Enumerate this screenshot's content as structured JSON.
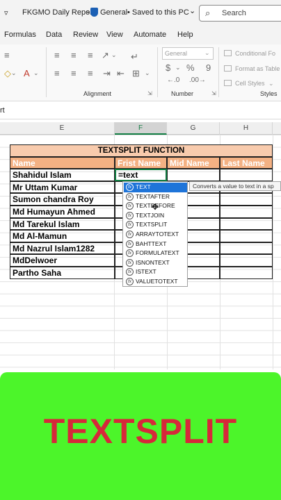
{
  "titlebar": {
    "dropdown_glyph": "▿",
    "file_name": "FKGMO Daily Report",
    "dropdown_arrow": "⌄",
    "sensitivity": "General",
    "save_state": "• Saved to this PC",
    "save_caret": "⌄",
    "search_placeholder": "Search"
  },
  "menu": [
    "Formulas",
    "Data",
    "Review",
    "View",
    "Automate",
    "Help"
  ],
  "ribbon": {
    "alignment_label": "Alignment",
    "number_label": "Number",
    "styles_label": "Styles",
    "number_format": "General",
    "conditional": "Conditional Fo",
    "format_as_table": "Format as Table",
    "cell_styles": "Cell Styles",
    "currency": "$",
    "percent": "%",
    "comma": "9"
  },
  "formula_bar": {
    "name_fragment": "rt"
  },
  "columns": [
    "E",
    "F",
    "G",
    "H"
  ],
  "table": {
    "title": "TEXTSPLIT FUNCTION",
    "headers": [
      "Name",
      "Frist Name",
      "Mid Name",
      "Last Name"
    ],
    "active_formula": "=text",
    "names": [
      "Shahidul Islam",
      "Mr Uttam Kumar",
      "Sumon chandra Roy",
      "Md Humayun Ahmed",
      "Md Tarekul Islam",
      "Md Al-Mamun",
      "Md Nazrul Islam1282",
      "MdDelwoer",
      "Partho Saha"
    ]
  },
  "autocomplete": {
    "items": [
      "TEXT",
      "TEXTAFTER",
      "TEXTBEFORE",
      "TEXTJOIN",
      "TEXTSPLIT",
      "ARRAYTOTEXT",
      "BAHTTEXT",
      "FORMULATEXT",
      "ISNONTEXT",
      "ISTEXT",
      "VALUETOTEXT"
    ],
    "selected": "TEXT",
    "tooltip": "Converts a value to text in a sp"
  },
  "banner": {
    "text": "TEXTSPLIT",
    "bg": "#4cf52a",
    "fg": "#d6283a"
  },
  "colors": {
    "header_fill": "#f4b183",
    "title_fill": "#f8cbad",
    "selection_blue": "#1e74d9",
    "active_cell_border": "#107c41"
  }
}
